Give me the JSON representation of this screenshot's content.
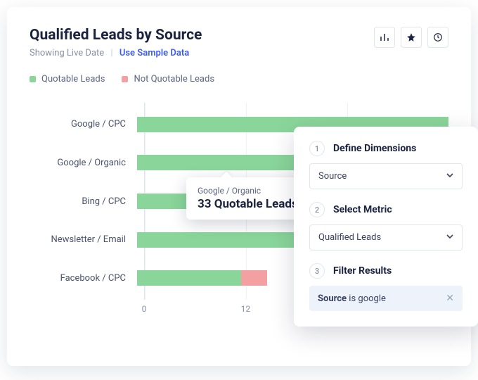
{
  "header": {
    "title": "Qualified Leads by Source",
    "subtitle": "Showing Live Date",
    "sample_link": "Use Sample Data"
  },
  "toolbar": {
    "chart_btn": "bar-chart-icon",
    "star_btn": "star-icon",
    "history_btn": "history-icon"
  },
  "legend": {
    "quotable": "Quotable Leads",
    "not_quotable": "Not Quotable Leads"
  },
  "tooltip": {
    "category": "Google / Organic",
    "value_text": "33 Quotable Leads"
  },
  "panel": {
    "step1": "Define Dimensions",
    "step1_value": "Source",
    "step2": "Select Metric",
    "step2_value": "Qualified Leads",
    "step3": "Filter Results",
    "filter_field": "Source",
    "filter_op": " is ",
    "filter_value": "google"
  },
  "chart_data": {
    "type": "bar",
    "orientation": "horizontal",
    "stacked": true,
    "categories": [
      "Google / CPC",
      "Google / Organic",
      "Bing / CPC",
      "Newsletter / Email",
      "Facebook / CPC"
    ],
    "series": [
      {
        "name": "Quotable Leads",
        "color": "#8ad69a",
        "values": [
          36,
          33,
          11,
          23,
          12
        ]
      },
      {
        "name": "Not Quotable Leads",
        "color": "#f4a0a3",
        "values": [
          0,
          0,
          0,
          5,
          3
        ]
      }
    ],
    "xticks": [
      0,
      12,
      24
    ],
    "xlim": [
      0,
      36
    ],
    "title": "Qualified Leads by Source",
    "xlabel": "",
    "ylabel": ""
  }
}
